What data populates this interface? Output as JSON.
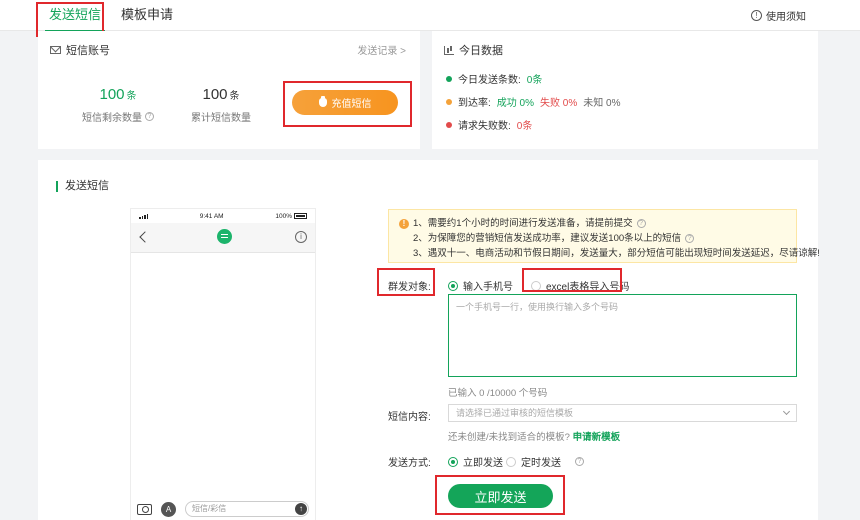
{
  "tabs": [
    "发送短信",
    "模板申请"
  ],
  "help_label": "使用须知",
  "account": {
    "title": "短信账号",
    "history_link": "发送记录 >",
    "remaining": {
      "value": "100",
      "unit": "条",
      "label": "短信剩余数量"
    },
    "total": {
      "value": "100",
      "unit": "条",
      "label": "累计短信数量"
    },
    "recharge_label": "充值短信"
  },
  "today": {
    "title": "今日数据",
    "sent_label": "今日发送条数:",
    "sent_value": "0条",
    "rate_label": "到达率:",
    "success": "成功 0%",
    "fail": "失败 0%",
    "unknown": "未知 0%",
    "request_fail_label": "请求失败数:",
    "request_fail_value": "0条"
  },
  "send": {
    "title": "发送短信",
    "phone": {
      "time": "9:41 AM",
      "battery": "100%",
      "input_placeholder": "短信/彩信"
    },
    "notice": [
      "1、需要约1个小时的时间进行发送准备，请提前提交",
      "2、为保障您的营销短信发送成功率，建议发送100条以上的短信",
      "3、遇双十一、电商活动和节假日期间，发送量大，部分短信可能出现短时间发送延迟，尽请谅解!"
    ],
    "target_label": "群发对象:",
    "target_options": [
      "输入手机号",
      "excel表格导入号码"
    ],
    "textarea_placeholder": "一个手机号一行，使用换行输入多个号码",
    "count_hint": "已输入 0 /10000 个号码",
    "content_label": "短信内容:",
    "content_placeholder": "请选择已通过审核的短信模板",
    "template_hint": "还未创建/未找到适合的模板?",
    "template_link": "申请新模板",
    "method_label": "发送方式:",
    "method_options": [
      "立即发送",
      "定时发送"
    ],
    "submit_label": "立即发送"
  },
  "colors": {
    "accent": "#13a35a",
    "orange": "#f7941f",
    "danger": "#e24b4b",
    "annotation": "#e0282c"
  }
}
